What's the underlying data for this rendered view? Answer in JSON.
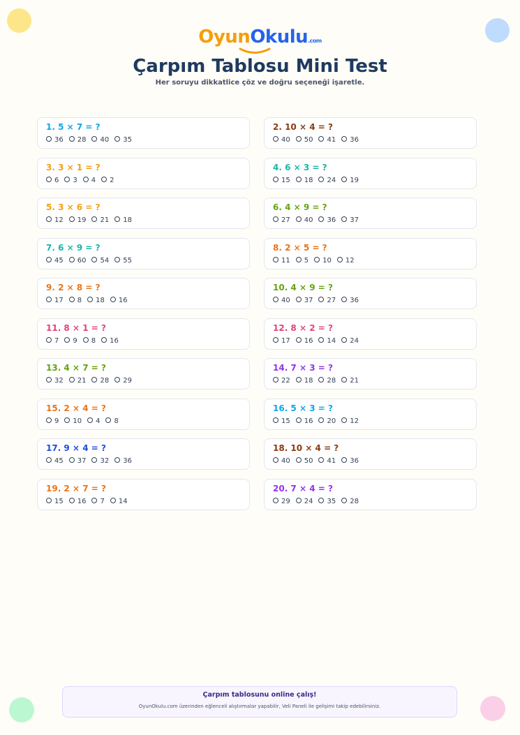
{
  "logo": {
    "oyun": "Oyun",
    "okulu": "Okulu",
    "com": ".com"
  },
  "title": "Çarpım Tablosu Mini Test",
  "subtitle": "Her soruyu dikkatlice çöz ve doğru seçeneği işaretle.",
  "colors": {
    "blue_sky": "#0ea5e9",
    "brown": "#8b3a0e",
    "orange": "#f59e0b",
    "teal": "#14b8a6",
    "olive": "#65a30d",
    "dark_orange": "#ea7317",
    "pink": "#e0457b",
    "purple": "#9333ea",
    "royal_blue": "#1d4ed8"
  },
  "questions": [
    {
      "label": "1. 5 × 7 = ?",
      "color": "#0ea5e9",
      "options": [
        "36",
        "28",
        "40",
        "35"
      ]
    },
    {
      "label": "2. 10 × 4 = ?",
      "color": "#8b3a0e",
      "options": [
        "40",
        "50",
        "41",
        "36"
      ]
    },
    {
      "label": "3. 3 × 1 = ?",
      "color": "#f59e0b",
      "options": [
        "6",
        "3",
        "4",
        "2"
      ]
    },
    {
      "label": "4. 6 × 3 = ?",
      "color": "#14b8a6",
      "options": [
        "15",
        "18",
        "24",
        "19"
      ]
    },
    {
      "label": "5. 3 × 6 = ?",
      "color": "#f59e0b",
      "options": [
        "12",
        "19",
        "21",
        "18"
      ]
    },
    {
      "label": "6. 4 × 9 = ?",
      "color": "#65a30d",
      "options": [
        "27",
        "40",
        "36",
        "37"
      ]
    },
    {
      "label": "7. 6 × 9 = ?",
      "color": "#14b8a6",
      "options": [
        "45",
        "60",
        "54",
        "55"
      ]
    },
    {
      "label": "8. 2 × 5 = ?",
      "color": "#ea7317",
      "options": [
        "11",
        "5",
        "10",
        "12"
      ]
    },
    {
      "label": "9. 2 × 8 = ?",
      "color": "#ea7317",
      "options": [
        "17",
        "8",
        "18",
        "16"
      ]
    },
    {
      "label": "10. 4 × 9 = ?",
      "color": "#65a30d",
      "options": [
        "40",
        "37",
        "27",
        "36"
      ]
    },
    {
      "label": "11. 8 × 1 = ?",
      "color": "#e0457b",
      "options": [
        "7",
        "9",
        "8",
        "16"
      ]
    },
    {
      "label": "12. 8 × 2 = ?",
      "color": "#e0457b",
      "options": [
        "17",
        "16",
        "14",
        "24"
      ]
    },
    {
      "label": "13. 4 × 7 = ?",
      "color": "#65a30d",
      "options": [
        "32",
        "21",
        "28",
        "29"
      ]
    },
    {
      "label": "14. 7 × 3 = ?",
      "color": "#9333ea",
      "options": [
        "22",
        "18",
        "28",
        "21"
      ]
    },
    {
      "label": "15. 2 × 4 = ?",
      "color": "#ea7317",
      "options": [
        "9",
        "10",
        "4",
        "8"
      ]
    },
    {
      "label": "16. 5 × 3 = ?",
      "color": "#0ea5e9",
      "options": [
        "15",
        "16",
        "20",
        "12"
      ]
    },
    {
      "label": "17. 9 × 4 = ?",
      "color": "#1d4ed8",
      "options": [
        "45",
        "37",
        "32",
        "36"
      ]
    },
    {
      "label": "18. 10 × 4 = ?",
      "color": "#8b3a0e",
      "options": [
        "40",
        "50",
        "41",
        "36"
      ]
    },
    {
      "label": "19. 2 × 7 = ?",
      "color": "#ea7317",
      "options": [
        "15",
        "16",
        "7",
        "14"
      ]
    },
    {
      "label": "20. 7 × 4 = ?",
      "color": "#9333ea",
      "options": [
        "29",
        "24",
        "35",
        "28"
      ]
    }
  ],
  "footer": {
    "heading": "Çarpım tablosunu online çalış!",
    "text": "OyunOkulu.com üzerinden eğlenceli alıştırmalar yapabilir, Veli Paneli ile gelişimi takip edebilirsiniz."
  },
  "decor_colors": {
    "top_left": "#fde68a",
    "top_right": "#bfdbfe",
    "bottom_left": "#bbf7d0",
    "bottom_right": "#fbcfe8"
  }
}
